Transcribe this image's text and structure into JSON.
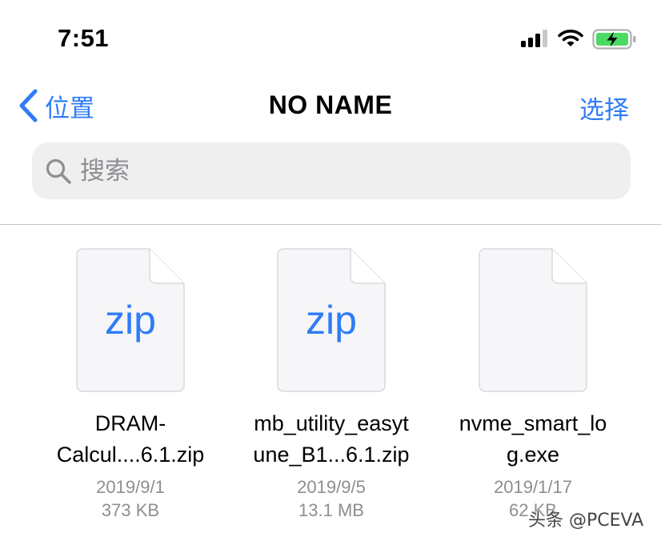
{
  "theme": {
    "accent": "#2f7cf6",
    "battery_green": "#4cd964",
    "secondary_text": "#8e8e93"
  },
  "status_bar": {
    "time": "7:51",
    "icons": [
      "signal-icon",
      "wifi-icon",
      "battery-charging-icon"
    ]
  },
  "nav": {
    "back_label": "位置",
    "title": "NO NAME",
    "select_label": "选择"
  },
  "search": {
    "placeholder": "搜索",
    "value": ""
  },
  "files": [
    {
      "icon_label": "zip",
      "name": "DRAM-\nCalcul....6.1.zip",
      "date": "2019/9/1",
      "size": "373 KB"
    },
    {
      "icon_label": "zip",
      "name": "mb_utility_easyt\nune_B1...6.1.zip",
      "date": "2019/9/5",
      "size": "13.1 MB"
    },
    {
      "icon_label": "",
      "name": "nvme_smart_lo\ng.exe",
      "date": "2019/1/17",
      "size": "62 KB"
    }
  ],
  "watermark": "头条 @PCEVA"
}
